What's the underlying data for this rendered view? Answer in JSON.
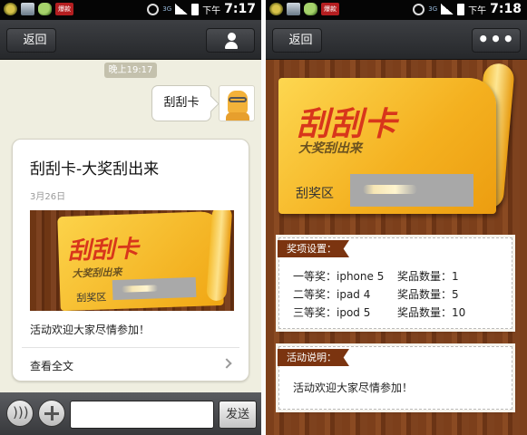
{
  "left_screen": {
    "status_bar": {
      "badge": "爆款",
      "ampm": "下午",
      "time": "7:17",
      "network": "3G"
    },
    "header": {
      "back_label": "返回"
    },
    "chat": {
      "time_divider": "晚上19:17",
      "outgoing_message": "刮刮卡",
      "news_card": {
        "title": "刮刮卡-大奖刮出来",
        "date": "3月26日",
        "image": {
          "title": "刮刮卡",
          "subtitle": "大奖刮出来",
          "area_label": "刮奖区"
        },
        "description": "活动欢迎大家尽情参加！",
        "read_more": "查看全文"
      }
    },
    "input_bar": {
      "send_label": "发送"
    }
  },
  "right_screen": {
    "status_bar": {
      "badge": "爆款",
      "ampm": "下午",
      "time": "7:18",
      "network": "3G"
    },
    "header": {
      "back_label": "返回",
      "more_label": "•••"
    },
    "ticket": {
      "title": "刮刮卡",
      "subtitle": "大奖刮出来",
      "area_label": "刮奖区"
    },
    "prizes": {
      "heading": "奖项设置：",
      "items": [
        {
          "prize": "一等奖：iphone 5",
          "quantity": "奖品数量：1"
        },
        {
          "prize": "二等奖：ipad 4",
          "quantity": "奖品数量：5"
        },
        {
          "prize": "三等奖：ipod 5",
          "quantity": "奖品数量：10"
        }
      ]
    },
    "activity": {
      "heading": "活动说明：",
      "text": "活动欢迎大家尽情参加！"
    }
  },
  "icons": [
    "coin-icon",
    "picture-icon",
    "chat-app-icon",
    "alarm-icon",
    "signal-icon",
    "battery-icon",
    "person-icon",
    "more-dots-icon",
    "chevron-right-icon",
    "voice-icon",
    "plus-icon"
  ],
  "colors": {
    "ticket_red": "#d8361b",
    "ticket_yellow": "#f4b01f",
    "panel_header": "#7b3410",
    "chat_bg": "#efeee0"
  }
}
